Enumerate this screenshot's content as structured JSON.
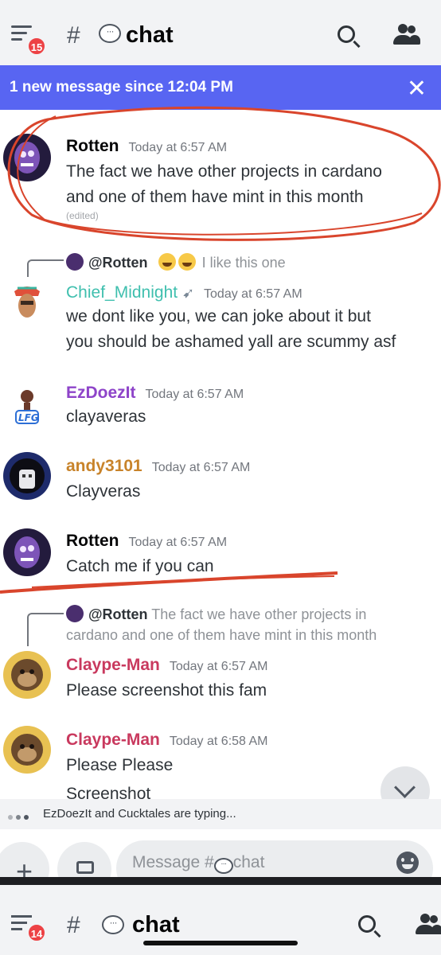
{
  "header": {
    "unread_count": "15",
    "hash": "#",
    "channel_icon": "speech-bubble-icon",
    "channel_name": "chat"
  },
  "banner": {
    "text": "1 new message since 12:04 PM",
    "close": "✕"
  },
  "messages": [
    {
      "author": "Rotten",
      "author_color": "#060607",
      "timestamp": "Today at 6:57 AM",
      "lines": [
        "The fact we have other projects in cardano",
        "and one of them have mint in this month"
      ],
      "edited": "(edited)"
    },
    {
      "reply": {
        "mention": "@Rotten",
        "text": "I like this one"
      },
      "author": "Chief_Midnight",
      "author_color": "#3fbfae",
      "timestamp": "Today at 6:57 AM",
      "lines": [
        "we dont like you, we can joke about it but",
        "you should be ashamed yall are scummy asf"
      ]
    },
    {
      "author": "EzDoezIt",
      "author_color": "#8e44c9",
      "timestamp": "Today at 6:57 AM",
      "lines": [
        "clayaveras"
      ]
    },
    {
      "author": "andy3101",
      "author_color": "#c8832a",
      "timestamp": "Today at 6:57 AM",
      "lines": [
        "Clayveras"
      ]
    },
    {
      "author": "Rotten",
      "author_color": "#060607",
      "timestamp": "Today at 6:57 AM",
      "lines": [
        "Catch me if you can"
      ]
    },
    {
      "reply": {
        "mention": "@Rotten",
        "text": "The fact we have other projects in",
        "text2": "cardano and one of them have mint in this month"
      },
      "author": "Claype-Man",
      "author_color": "#c9395e",
      "timestamp": "Today at 6:57 AM",
      "lines": [
        "Please screenshot this fam"
      ]
    },
    {
      "author": "Claype-Man",
      "author_color": "#c9395e",
      "timestamp": "Today at 6:58 AM",
      "lines": [
        "Please Please",
        "Screenshot"
      ]
    }
  ],
  "typing": {
    "text": "EzDoezIt and Cucktales are typing..."
  },
  "composer": {
    "plus": "+",
    "placeholder_prefix": "Message #",
    "placeholder_channel": "chat"
  },
  "second_header": {
    "unread_count": "14",
    "hash": "#",
    "channel_name": "chat"
  }
}
